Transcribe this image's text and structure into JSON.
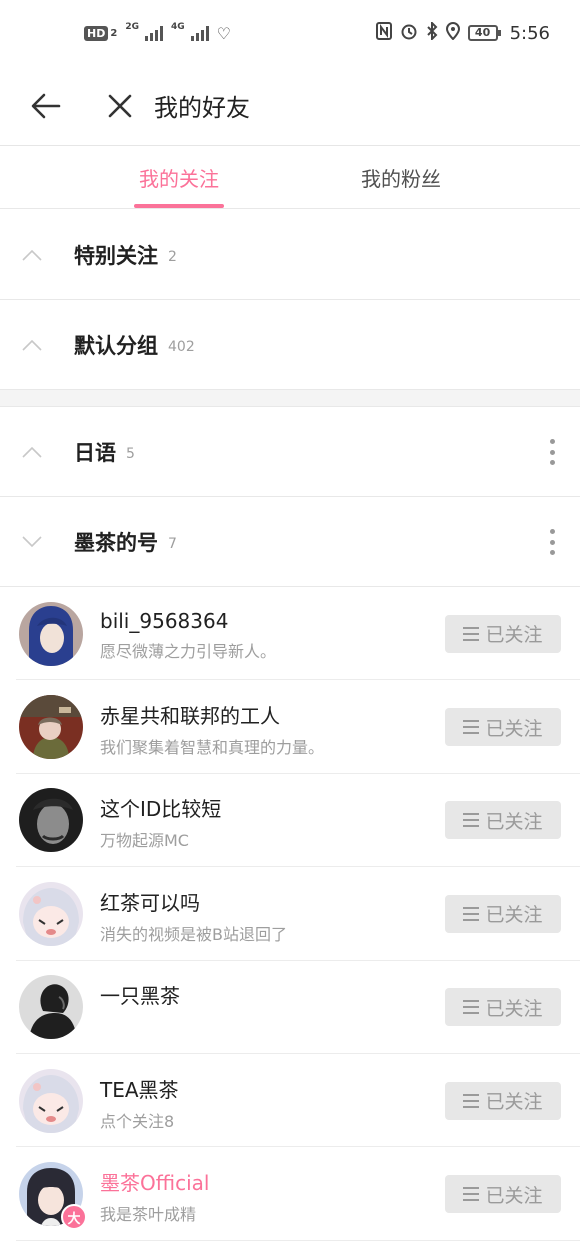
{
  "status_bar": {
    "hd_label": "HD",
    "hd_sub": "2",
    "sim1_label": "2G",
    "sim2_label": "4G",
    "battery": "40",
    "time": "5:56"
  },
  "header": {
    "title": "我的好友"
  },
  "tabs": [
    {
      "label": "我的关注",
      "active": true
    },
    {
      "label": "我的粉丝",
      "active": false
    }
  ],
  "groups": [
    {
      "name": "特别关注",
      "count": "2",
      "expanded": false
    },
    {
      "name": "默认分组",
      "count": "402",
      "expanded": false
    },
    {
      "name": "日语",
      "count": "5",
      "expanded": false
    },
    {
      "name": "墨茶的号",
      "count": "7",
      "expanded": true
    }
  ],
  "follow_label": "已关注",
  "friends": [
    {
      "name": "bili_9568364",
      "sign": "愿尽微薄之力引导新人。",
      "avatar_color": "#2a3f8f",
      "avatar_accent": "#e9dcd2"
    },
    {
      "name": "赤星共和联邦的工人",
      "sign": "我们聚集着智慧和真理的力量。",
      "avatar_color": "#8a3b2a",
      "avatar_accent": "#c9b79a"
    },
    {
      "name": "这个ID比较短",
      "sign": "万物起源MC",
      "avatar_color": "#2b2b2b",
      "avatar_accent": "#8c8c8c"
    },
    {
      "name": "红茶可以吗",
      "sign": "消失的视频是被B站退回了",
      "avatar_color": "#e6d8e6",
      "avatar_accent": "#f2c5c5"
    },
    {
      "name": "一只黑茶",
      "sign": "",
      "avatar_color": "#d9d9d9",
      "avatar_accent": "#1f1f1f"
    },
    {
      "name": "TEA黑茶",
      "sign": "点个关注8",
      "avatar_color": "#e6d8e6",
      "avatar_accent": "#f2c5c5"
    },
    {
      "name": "墨茶Official",
      "sign": "我是茶叶成精",
      "avatar_color": "#c6d3ea",
      "avatar_accent": "#2a2a35",
      "vip": "大",
      "name_pink": true
    }
  ]
}
